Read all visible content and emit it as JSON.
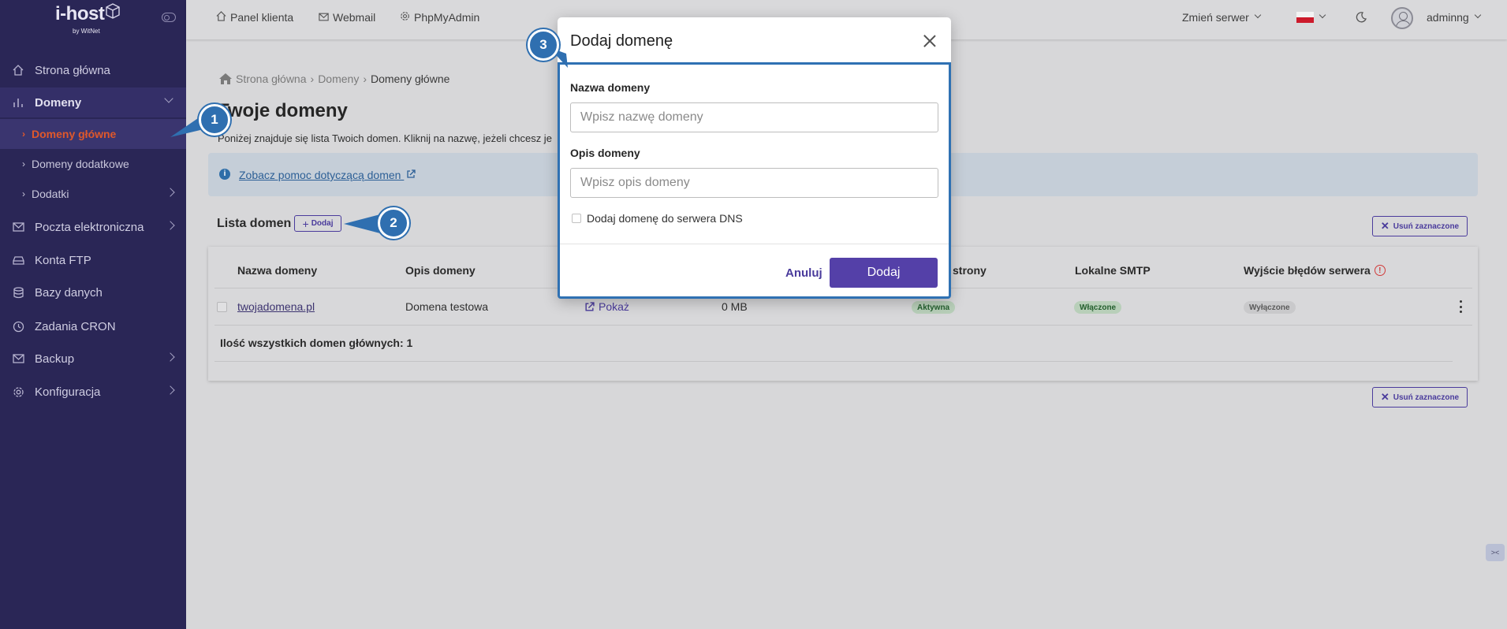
{
  "brand": {
    "name": "i-host",
    "sub": "by WitNet"
  },
  "sidebar": {
    "items": [
      {
        "label": "Strona główna",
        "icon": "home-icon"
      },
      {
        "label": "Domeny",
        "icon": "chart-icon"
      },
      {
        "label": "Domeny główne"
      },
      {
        "label": "Domeny dodatkowe"
      },
      {
        "label": "Dodatki"
      },
      {
        "label": "Poczta elektroniczna",
        "icon": "mail-icon"
      },
      {
        "label": "Konta FTP",
        "icon": "drive-icon"
      },
      {
        "label": "Bazy danych",
        "icon": "database-icon"
      },
      {
        "label": "Zadania CRON",
        "icon": "clock-icon"
      },
      {
        "label": "Backup",
        "icon": "envelope-icon"
      },
      {
        "label": "Konfiguracja",
        "icon": "gear-icon"
      }
    ]
  },
  "topbar": {
    "links": [
      "Panel klienta",
      "Webmail",
      "PhpMyAdmin"
    ],
    "server": "Zmień serwer",
    "user": "adminng"
  },
  "breadcrumb": [
    "Strona główna",
    "Domeny",
    "Domeny główne"
  ],
  "page": {
    "title": "Twoje domeny",
    "description": "Poniżej znajduje się lista Twoich domen. Kliknij na nazwę, jeżeli chcesz je",
    "help_link": "Zobacz pomoc dotyczącą domen"
  },
  "list": {
    "title": "Lista domen",
    "add_label": "Dodaj",
    "delete_label": "Usuń zaznaczone",
    "columns": [
      "Nazwa domeny",
      "Opis domeny",
      "strony",
      "Lokalne SMTP",
      "Wyjście błędów serwera"
    ],
    "row": {
      "domain": "twojadomena.pl",
      "description": "Domena testowa",
      "preview": "Pokaż",
      "size": "0 MB",
      "status": "Aktywna",
      "smtp": "Włączone",
      "errors": "Wyłączone"
    },
    "total": "Ilość wszystkich domen głównych: 1"
  },
  "modal": {
    "title": "Dodaj domenę",
    "name_label": "Nazwa domeny",
    "name_placeholder": "Wpisz nazwę domeny",
    "desc_label": "Opis domeny",
    "desc_placeholder": "Wpisz opis domeny",
    "dns_label": "Dodaj domenę do serwera DNS",
    "cancel": "Anuluj",
    "submit": "Dodaj"
  },
  "callouts": [
    "1",
    "2",
    "3"
  ],
  "colors": {
    "sidebar": "#2a2656",
    "accent": "#5440a8",
    "active": "#e0582b",
    "callout": "#2f6fb0"
  }
}
